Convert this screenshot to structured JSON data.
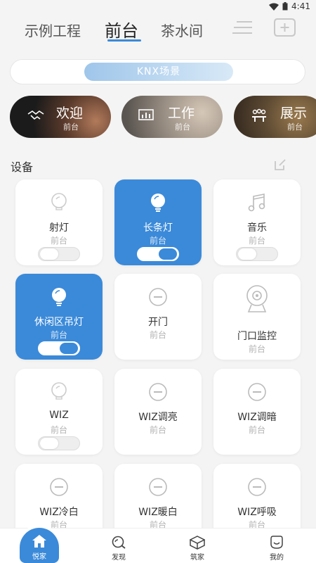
{
  "status_bar": {
    "time": "4:41"
  },
  "top_tabs": [
    {
      "label": "示例工程",
      "active": false
    },
    {
      "label": "前台",
      "active": true
    },
    {
      "label": "茶水间",
      "active": false
    }
  ],
  "scene_bar": {
    "label": "KNX场景"
  },
  "scenes": [
    {
      "title": "欢迎",
      "room": "前台"
    },
    {
      "title": "工作",
      "room": "前台"
    },
    {
      "title": "展示",
      "room": "前台"
    }
  ],
  "devices_section": {
    "title": "设备"
  },
  "devices": [
    {
      "name": "射灯",
      "room": "前台",
      "on": false
    },
    {
      "name": "长条灯",
      "room": "前台",
      "on": true
    },
    {
      "name": "音乐",
      "room": "前台",
      "on": false
    },
    {
      "name": "休闲区吊灯",
      "room": "前台",
      "on": true
    },
    {
      "name": "开门",
      "room": "前台"
    },
    {
      "name": "门口监控",
      "room": "前台"
    },
    {
      "name": "WIZ",
      "room": "前台",
      "on": false
    },
    {
      "name": "WIZ调亮",
      "room": "前台"
    },
    {
      "name": "WIZ调暗",
      "room": "前台"
    },
    {
      "name": "WIZ冷白",
      "room": "前台"
    },
    {
      "name": "WIZ暖白",
      "room": "前台"
    },
    {
      "name": "WIZ呼吸",
      "room": "前台"
    }
  ],
  "bottom_nav": [
    {
      "label": "悦家",
      "icon": "home-icon",
      "active": true
    },
    {
      "label": "发现",
      "icon": "discover-icon",
      "active": false
    },
    {
      "label": "筑家",
      "icon": "box-icon",
      "active": false
    },
    {
      "label": "我的",
      "icon": "profile-icon",
      "active": false
    }
  ],
  "colors": {
    "accent": "#3b8ad9",
    "background": "#f4f4f4"
  }
}
